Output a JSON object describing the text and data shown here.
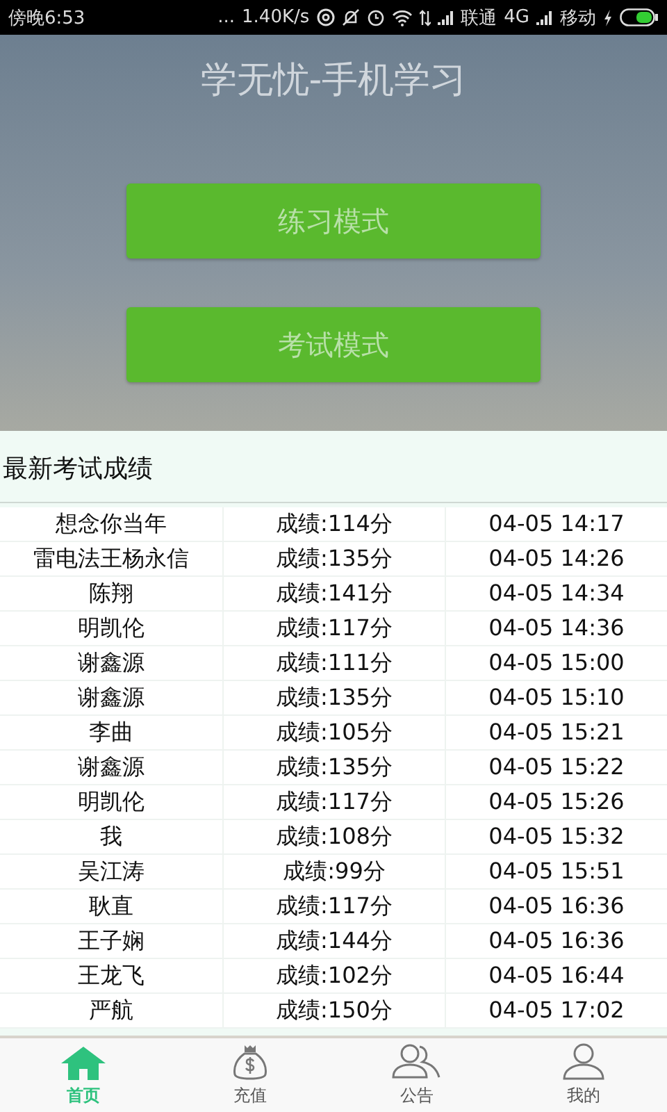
{
  "status_bar": {
    "time": "傍晚6:53",
    "dots": "...",
    "speed": "1.40K/s",
    "carrier_1": "联通",
    "network": "4G",
    "carrier_2": "移动"
  },
  "header": {
    "title": "学无忧-手机学习",
    "buttons": [
      "练习模式",
      "考试模式"
    ]
  },
  "scores": {
    "title": "最新考试成绩",
    "rows": [
      {
        "name": "想念你当年",
        "score": "成绩:114分",
        "time": "04-05 14:17"
      },
      {
        "name": "雷电法王杨永信",
        "score": "成绩:135分",
        "time": "04-05 14:26"
      },
      {
        "name": "陈翔",
        "score": "成绩:141分",
        "time": "04-05 14:34"
      },
      {
        "name": "明凯伦",
        "score": "成绩:117分",
        "time": "04-05 14:36"
      },
      {
        "name": "谢鑫源",
        "score": "成绩:111分",
        "time": "04-05 15:00"
      },
      {
        "name": "谢鑫源",
        "score": "成绩:135分",
        "time": "04-05 15:10"
      },
      {
        "name": "李曲",
        "score": "成绩:105分",
        "time": "04-05 15:21"
      },
      {
        "name": "谢鑫源",
        "score": "成绩:135分",
        "time": "04-05 15:22"
      },
      {
        "name": "明凯伦",
        "score": "成绩:117分",
        "time": "04-05 15:26"
      },
      {
        "name": "我",
        "score": "成绩:108分",
        "time": "04-05 15:32"
      },
      {
        "name": "吴江涛",
        "score": "成绩:99分",
        "time": "04-05 15:51"
      },
      {
        "name": "耿直",
        "score": "成绩:117分",
        "time": "04-05 16:36"
      },
      {
        "name": "王子娴",
        "score": "成绩:144分",
        "time": "04-05 16:36"
      },
      {
        "name": "王龙飞",
        "score": "成绩:102分",
        "time": "04-05 16:44"
      },
      {
        "name": "严航",
        "score": "成绩:150分",
        "time": "04-05 17:02"
      }
    ]
  },
  "tabs": [
    {
      "kind": "home",
      "label": "首页",
      "selected": true
    },
    {
      "kind": "money",
      "label": "充值",
      "selected": false
    },
    {
      "kind": "group",
      "label": "公告",
      "selected": false
    },
    {
      "kind": "person",
      "label": "我的",
      "selected": false
    }
  ]
}
